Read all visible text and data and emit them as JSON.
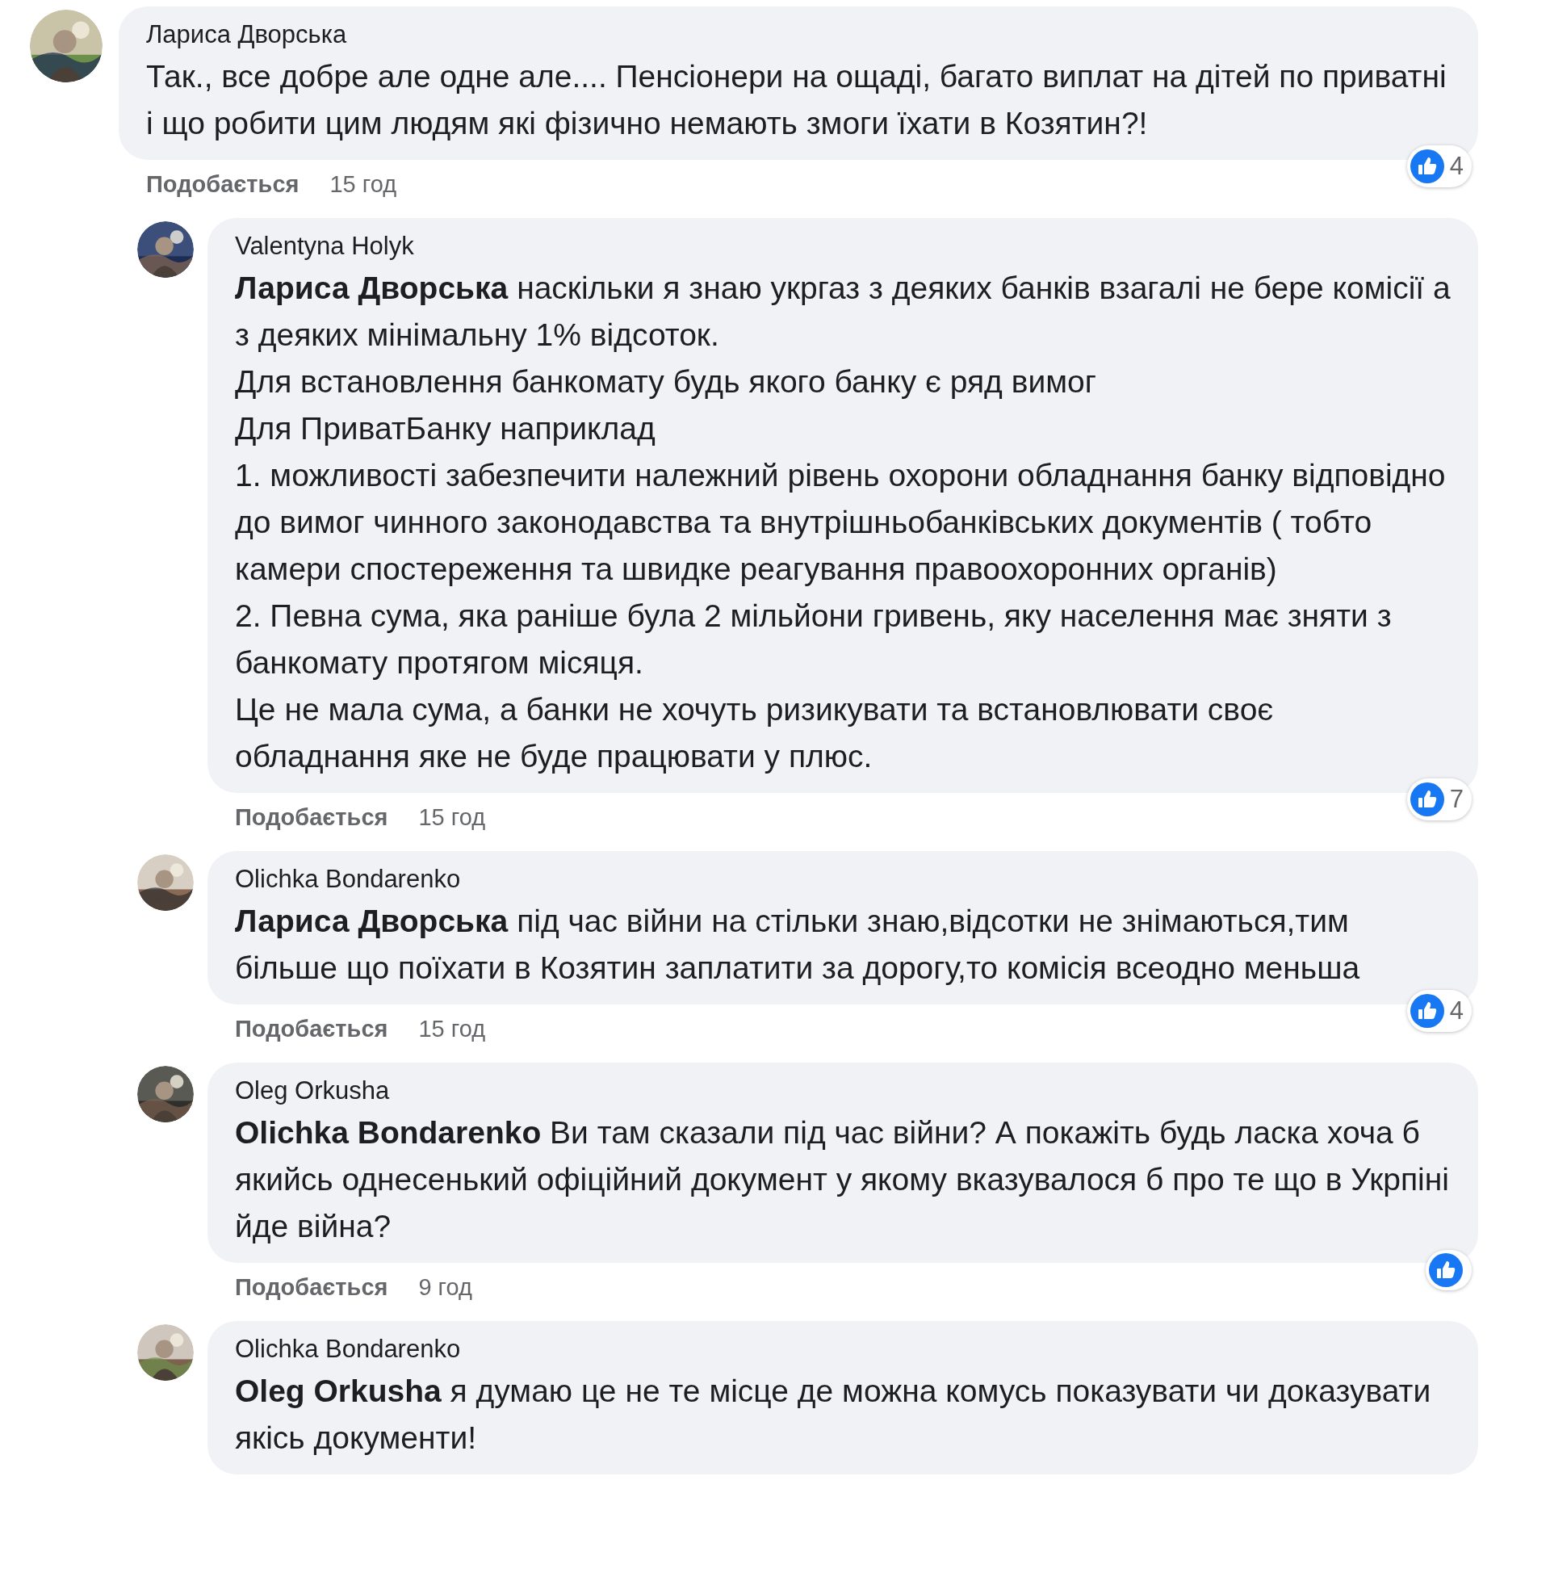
{
  "comments": [
    {
      "author": "Лариса Дворська",
      "reply": false,
      "paragraphs": [
        "Так., все добре але одне але.... Пенсіонери на ощаді, багато виплат на дітей по приватні і що робити цим людям які фізично немають змоги їхати в Козятин?!"
      ],
      "like_label": "Подобається",
      "time": "15 год",
      "reaction_badge": true,
      "reaction_count": "4"
    },
    {
      "author": "Valentyna Holyk",
      "reply": true,
      "mention": "Лариса Дворська",
      "paragraphs": [
        "наскільки я знаю укргаз з деяких банків взагалі не бере комісії а з деяких мінімальну 1% відсоток.",
        "Для встановлення банкомату будь якого банку є ряд вимог",
        "Для ПриватБанку наприклад",
        "1. можливості забезпечити належний рівень охорони обладнання банку відповідно до вимог чинного законодавства та внутрішньобанківських документів ( тобто камери спостереження та швидке реагування правоохоронних органів)",
        "2. Певна сума, яка раніше була 2 мільйони гривень, яку населення має зняти з банкомату протягом місяця.",
        "Це не мала сума, а банки не хочуть ризикувати та встановлювати своє обладнання яке не буде працювати у плюс."
      ],
      "like_label": "Подобається",
      "time": "15 год",
      "reaction_badge": true,
      "reaction_count": "7"
    },
    {
      "author": "Olichka Bondarenko",
      "reply": true,
      "mention": "Лариса Дворська",
      "paragraphs": [
        "під час війни на стільки знаю,відсотки не знімаються,тим більше що поїхати в Козятин заплатити за дорогу,то комісія всеодно меньша"
      ],
      "like_label": "Подобається",
      "time": "15 год",
      "reaction_badge": true,
      "reaction_count": "4"
    },
    {
      "author": "Oleg Orkusha",
      "reply": true,
      "mention": "Olichka Bondarenko",
      "paragraphs": [
        "Ви там сказали під час війни? А покажіть будь ласка хоча б якийсь однесенький офіційний документ у якому вказувалося б про те що в Укрпіні йде війна?"
      ],
      "like_label": "Подобається",
      "time": "9 год",
      "reaction_badge": true
    },
    {
      "author": "Olichka Bondarenko",
      "reply": true,
      "mention": "Oleg Orkusha",
      "paragraphs": [
        "я думаю це не те місце де можна комусь показувати чи доказувати якісь документи!"
      ],
      "reaction_badge": false
    }
  ]
}
